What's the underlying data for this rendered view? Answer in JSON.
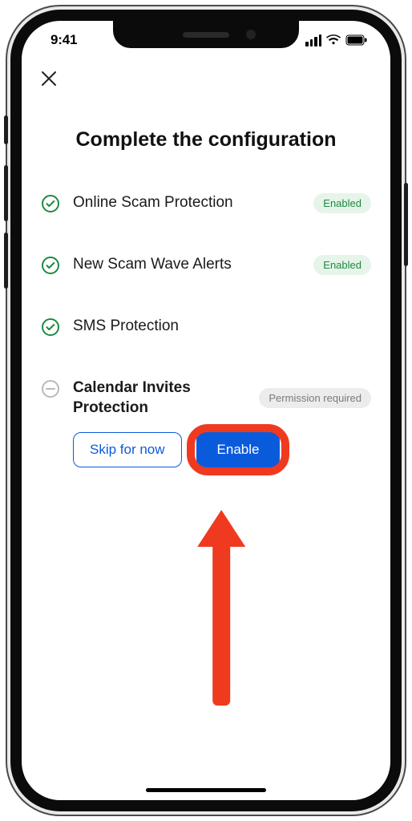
{
  "status": {
    "time": "9:41"
  },
  "page": {
    "title": "Complete the configuration"
  },
  "badges": {
    "enabled": "Enabled",
    "permission_required": "Permission required"
  },
  "features": [
    {
      "label": "Online Scam Protection"
    },
    {
      "label": "New Scam Wave Alerts"
    },
    {
      "label": "SMS Protection"
    },
    {
      "label": "Calendar Invites Protection"
    }
  ],
  "actions": {
    "skip": "Skip for now",
    "enable": "Enable"
  },
  "colors": {
    "accent": "#0a5bdc",
    "highlight": "#ef3a20",
    "success": "#1d8a3e"
  }
}
